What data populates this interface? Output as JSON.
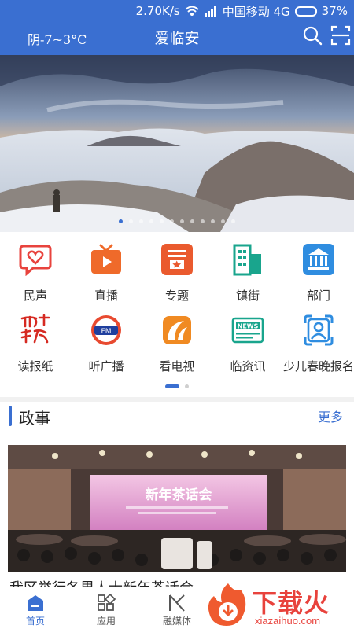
{
  "status_bar": {
    "speed": "2.70K/s",
    "carrier": "中国移动 4G",
    "battery_percent": "37%",
    "battery_level": 0.37
  },
  "app_bar": {
    "weather": "阴-7~3°C",
    "title": "爱临安"
  },
  "banner": {
    "slide_count": 12,
    "active_slide": 0
  },
  "grid": {
    "items": [
      {
        "label": "民声",
        "icon": "heart-chat-icon",
        "color": "#e8433d"
      },
      {
        "label": "直播",
        "icon": "live-tv-icon",
        "color": "#ef6a2a"
      },
      {
        "label": "专题",
        "icon": "topic-box-icon",
        "color": "#ea5a2e"
      },
      {
        "label": "镇街",
        "icon": "building-icon",
        "color": "#19a58d"
      },
      {
        "label": "部门",
        "icon": "government-icon",
        "color": "#2f8de0"
      },
      {
        "label": "读报纸",
        "icon": "newspaper-logo-icon",
        "color": "#d62a22"
      },
      {
        "label": "听广播",
        "icon": "radio-logo-icon",
        "color": "#e84a30"
      },
      {
        "label": "看电视",
        "icon": "tv-logo-icon",
        "color": "#f08a22"
      },
      {
        "label": "临资讯",
        "icon": "news-icon",
        "color": "#19a58d"
      },
      {
        "label": "少儿春晚报名",
        "icon": "portrait-frame-icon",
        "color": "#2f8de0"
      }
    ],
    "pages": 2,
    "active_page": 0
  },
  "section": {
    "title": "政事",
    "more": "更多"
  },
  "news": {
    "title": "我区举行各界人士新年茶话会",
    "banner_text": "新年茶话会"
  },
  "tabs": [
    {
      "label": "首页",
      "icon": "home-icon",
      "active": true
    },
    {
      "label": "应用",
      "icon": "apps-icon",
      "active": false
    },
    {
      "label": "融媒体",
      "icon": "media-icon",
      "active": false
    }
  ],
  "watermark": {
    "brand": "下载火",
    "url": "xiazaihuo.com"
  },
  "colors": {
    "primary": "#3a6fd1",
    "accent": "#e8423c"
  }
}
